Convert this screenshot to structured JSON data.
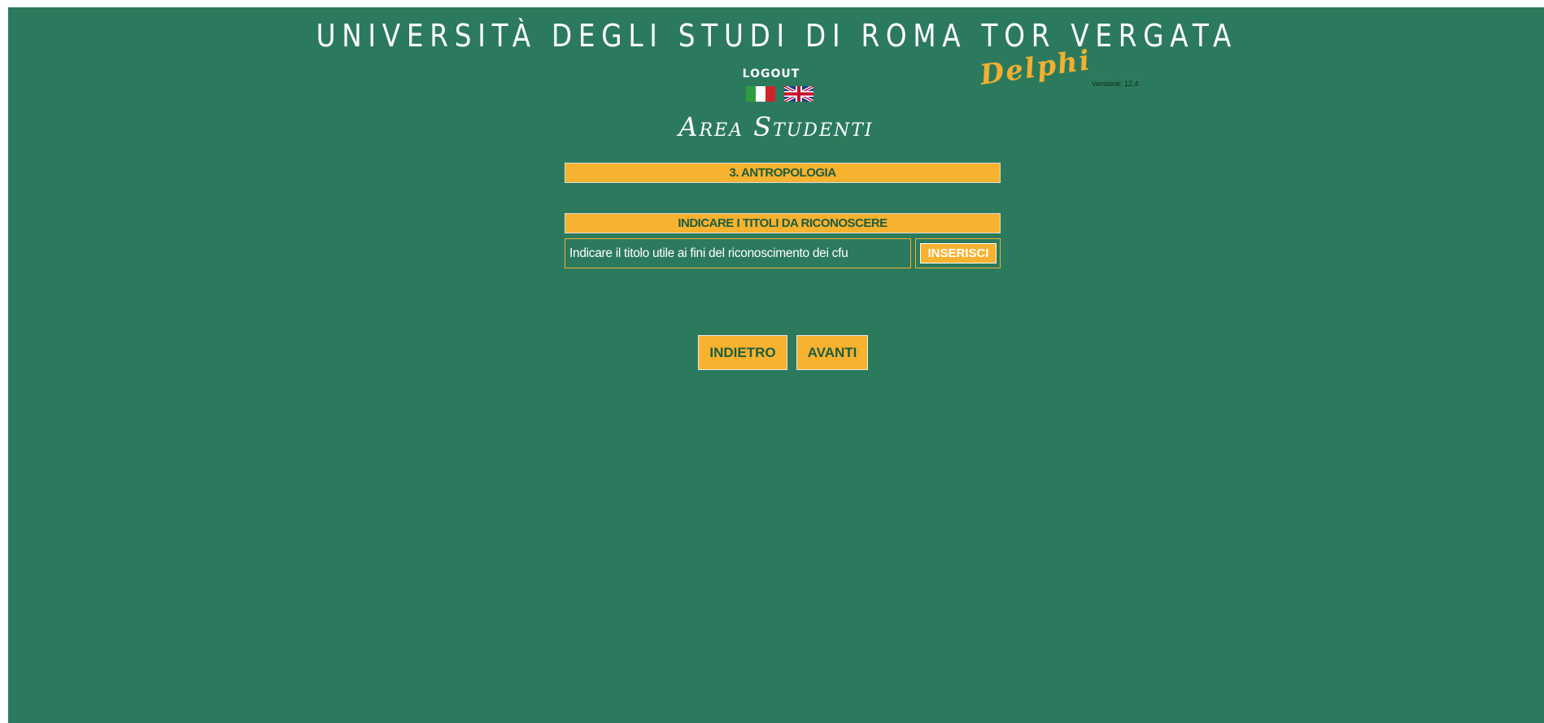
{
  "header": {
    "university_title": "UNIVERSITÀ DEGLI STUDI DI ROMA TOR VERGATA",
    "logout_label": "LOGOUT",
    "logo_text": "Delphi",
    "version_label": "Versione: 12.4",
    "area_title": "Area Studenti"
  },
  "languages": [
    {
      "name": "Italiano",
      "icon": "italian-flag-icon"
    },
    {
      "name": "English",
      "icon": "uk-flag-icon"
    }
  ],
  "main": {
    "course_banner": "3. ANTROPOLOGIA",
    "titles_banner": "INDICARE I TITOLI DA RICONOSCERE",
    "title_input": {
      "value": "",
      "placeholder": "Indicare il titolo utile ai fini del riconoscimento dei cfu"
    },
    "insert_button": "INSERISCI"
  },
  "footer_nav": {
    "back_label": "INDIETRO",
    "next_label": "AVANTI"
  },
  "colors": {
    "background": "#2c7a5d",
    "accent": "#f7b230",
    "accent_text": "#1d5c3c",
    "text_light": "#ffffff"
  }
}
